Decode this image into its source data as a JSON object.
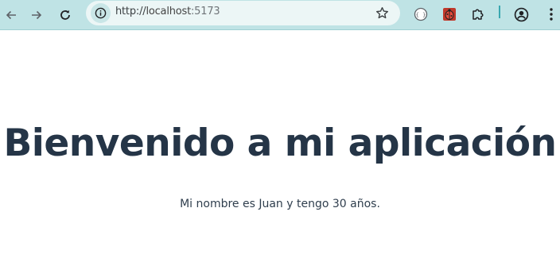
{
  "browser": {
    "url_scheme": "http://",
    "url_host": "localhost",
    "url_port": ":5173",
    "toolbar_color": "#bfe3e5",
    "icons": {
      "back": "arrow-left-icon",
      "forward": "arrow-right-icon",
      "reload": "reload-icon",
      "site_info": "info-icon",
      "bookmark": "star-icon",
      "extension1": "code-brackets-icon",
      "extension2": "ladybug-icon",
      "extensions": "puzzle-icon",
      "profile": "user-circle-icon",
      "menu": "kebab-menu-icon"
    }
  },
  "page": {
    "heading": "Bienvenido a mi aplicación",
    "subtitle": "Mi nombre es Juan y tengo 30 años.",
    "heading_color": "#253547",
    "text_color": "#2f3e4d"
  }
}
